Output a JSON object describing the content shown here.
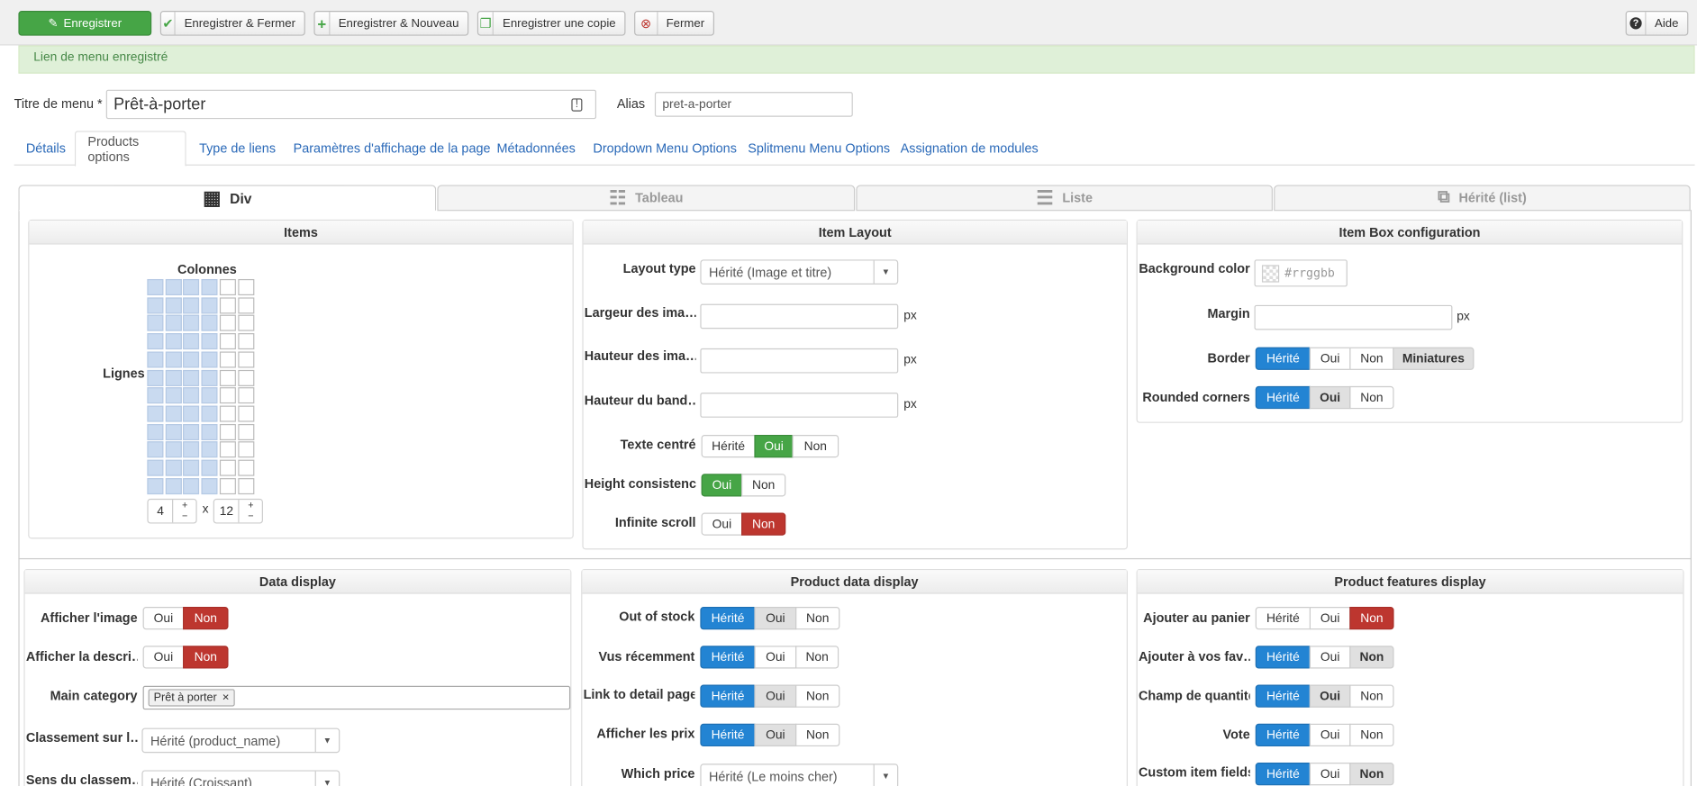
{
  "toolbar": {
    "save": "Enregistrer",
    "save_close": "Enregistrer & Fermer",
    "save_new": "Enregistrer & Nouveau",
    "save_copy": "Enregistrer une copie",
    "close": "Fermer",
    "help": "Aide"
  },
  "message": "Lien de menu enregistré",
  "title_field": {
    "label": "Titre de menu *",
    "value": "Prêt-à-porter"
  },
  "alias_field": {
    "label": "Alias",
    "value": "pret-a-porter"
  },
  "tabs": [
    "Détails",
    "Products options",
    "Type de liens",
    "Paramètres d'affichage de la page",
    "Métadonnées",
    "Dropdown Menu Options",
    "Splitmenu Menu Options",
    "Assignation de modules"
  ],
  "layout_tabs": [
    "Div",
    "Tableau",
    "Liste",
    "Hérité (list)"
  ],
  "items_panel": {
    "title": "Items",
    "columns_label": "Colonnes",
    "rows_label": "Lignes",
    "columns": 4,
    "rows": 12,
    "x": "x"
  },
  "item_layout": {
    "title": "Item Layout",
    "layout_type": "Layout type",
    "layout_value": "Hérité (Image et titre)",
    "img_width": "Largeur des ima…",
    "img_height": "Hauteur des ima…",
    "band_height": "Hauteur du band…",
    "px": "px",
    "centered": "Texte centré",
    "height_consistency": "Height consistency",
    "infinite_scroll": "Infinite scroll"
  },
  "box_config": {
    "title": "Item Box configuration",
    "bg_color": "Background color",
    "bg_placeholder": "#rrggbb",
    "margin": "Margin",
    "px": "px",
    "border": "Border",
    "rounded": "Rounded corners"
  },
  "data_display": {
    "title": "Data display",
    "show_image": "Afficher l'image",
    "show_desc": "Afficher la descri…",
    "main_category": "Main category",
    "category_tag": "Prêt à porter",
    "sort_by": "Classement sur l…",
    "sort_value": "Hérité (product_name)",
    "sort_dir": "Sens du classem…",
    "sort_dir_value": "Hérité (Croissant)"
  },
  "product_data": {
    "title": "Product data display",
    "out_of_stock": "Out of stock",
    "recently": "Vus récemment",
    "detail_link": "Link to detail page",
    "show_prices": "Afficher les prix",
    "which_price": "Which price",
    "which_price_value": "Hérité (Le moins cher)"
  },
  "features": {
    "title": "Product features display",
    "add_cart": "Ajouter au panier",
    "add_fav": "Ajouter à vos fav…",
    "quantity": "Champ de quantité",
    "vote": "Vote",
    "custom_fields": "Custom item fields"
  },
  "options": {
    "inherited": "Hérité",
    "yes": "Oui",
    "no": "Non",
    "thumbs": "Miniatures"
  },
  "colors": {
    "blue": "#2384d3",
    "green": "#46a546",
    "red": "#bd362f"
  }
}
